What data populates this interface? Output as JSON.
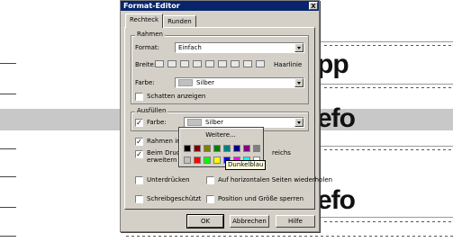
{
  "background": {
    "fragments": [
      "pp",
      "efo",
      "efo"
    ]
  },
  "dialog": {
    "title": "Format-Editor",
    "close": "X",
    "tabs": [
      {
        "label": "Rechteck",
        "active": true
      },
      {
        "label": "Runden",
        "active": false
      }
    ],
    "rahmen": {
      "group_label": "Rahmen",
      "format_label": "Format:",
      "format_value": "Einfach",
      "breite_label": "Breite:",
      "width_count": 9,
      "haarlinie_label": "Haarlinie",
      "farbe_label": "Farbe:",
      "farbe_value": "Silber",
      "shadow_label": "Schatten anzeigen",
      "shadow_checked": false
    },
    "ausfuellen": {
      "group_label": "Ausfüllen",
      "farbe_label": "Farbe:",
      "farbe_checked": true,
      "farbe_value": "Silber"
    },
    "options": {
      "rahmen_im": "Rahmen imm",
      "rahmen_im_checked": true,
      "beim_druck_1": "Beim Druck",
      "beim_druck_2": "erweitern",
      "beim_druck_checked": true,
      "reichs_suffix": "reichs",
      "unterdruecken": "Unterdrücken",
      "unterdruecken_checked": false,
      "horizontal": "Auf horizontalen Seiten wiederholen",
      "horizontal_checked": false,
      "schreibgeschuetzt": "Schreibgeschützt",
      "schreibgeschuetzt_checked": false,
      "position_groesse": "Position und Größe sperren",
      "position_groesse_checked": false
    },
    "buttons": {
      "ok": "OK",
      "cancel": "Abbrechen",
      "help": "Hilfe"
    },
    "checkmark": "✓"
  },
  "color_popup": {
    "more_label": "Weitere...",
    "tooltip": "Dunkelblau",
    "row1": [
      "#000000",
      "#800000",
      "#808000",
      "#008000",
      "#008080",
      "#000080",
      "#800080",
      "#808080"
    ],
    "row2": [
      "#c0c0c0",
      "#ff0000",
      "#00ff00",
      "#ffff00",
      "#0000ff",
      "#ff00ff",
      "#00ffff",
      "#ffffff"
    ]
  }
}
